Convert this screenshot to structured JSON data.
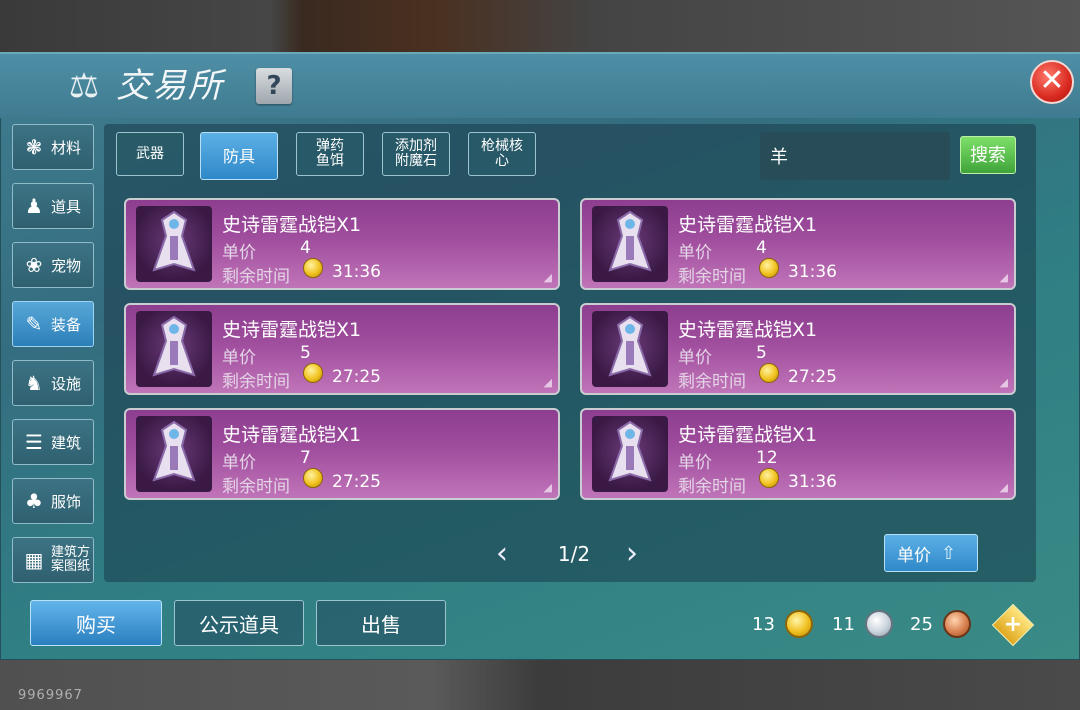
{
  "window": {
    "title": "交易所",
    "help_label": "?",
    "close_label": "✕"
  },
  "categories": [
    {
      "label": "材料",
      "icon": "materials-icon",
      "active": false
    },
    {
      "label": "道具",
      "icon": "items-icon",
      "active": false
    },
    {
      "label": "宠物",
      "icon": "pet-paw-icon",
      "active": false
    },
    {
      "label": "装备",
      "icon": "equipment-icon",
      "active": true
    },
    {
      "label": "设施",
      "icon": "facility-icon",
      "active": false
    },
    {
      "label": "建筑",
      "icon": "building-icon",
      "active": false
    },
    {
      "label": "服饰",
      "icon": "clothing-icon",
      "active": false
    },
    {
      "label": "建筑方\n案图纸",
      "icon": "blueprint-icon",
      "active": false
    }
  ],
  "tabs": [
    {
      "label": "武器",
      "active": false
    },
    {
      "label": "防具",
      "active": true
    },
    {
      "label": "弹药\n鱼饵",
      "active": false
    },
    {
      "label": "添加剂\n附魔石",
      "active": false
    },
    {
      "label": "枪械核\n心",
      "active": false
    }
  ],
  "search": {
    "value": "羊",
    "button_label": "搜索"
  },
  "listing_labels": {
    "price": "单价",
    "time": "剩余时间"
  },
  "listings": [
    {
      "name": "史诗雷霆战铠X1",
      "price": "4",
      "time": "31:36"
    },
    {
      "name": "史诗雷霆战铠X1",
      "price": "4",
      "time": "31:36"
    },
    {
      "name": "史诗雷霆战铠X1",
      "price": "5",
      "time": "27:25"
    },
    {
      "name": "史诗雷霆战铠X1",
      "price": "5",
      "time": "27:25"
    },
    {
      "name": "史诗雷霆战铠X1",
      "price": "7",
      "time": "27:25"
    },
    {
      "name": "史诗雷霆战铠X1",
      "price": "12",
      "time": "31:36"
    }
  ],
  "pagination": {
    "text": "1/2",
    "prev": "‹",
    "next": "›"
  },
  "sort": {
    "label": "单价"
  },
  "bottom": {
    "buy": "购买",
    "public_items": "公示道具",
    "sell": "出售"
  },
  "currencies": {
    "gold": "13",
    "silver": "11",
    "bronze": "25"
  },
  "watermark": "9969967",
  "colors": {
    "active_blue": "#2f88c8",
    "listing_purple": "#a04e9e",
    "search_green": "#3fa43a",
    "close_red": "#d92a20"
  }
}
